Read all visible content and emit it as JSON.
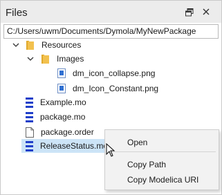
{
  "panel": {
    "title": "Files",
    "float_icon": "float-window-icon",
    "close_icon": "close-icon"
  },
  "path": {
    "value": "C:/Users/uwm/Documents/Dymola/MyNewPackage"
  },
  "tree": {
    "items": [
      {
        "label": "Resources",
        "icon": "folder-icon",
        "expanded": true
      },
      {
        "label": "Images",
        "icon": "folder-icon",
        "expanded": true
      },
      {
        "label": "dm_icon_collapse.png",
        "icon": "image-file-icon"
      },
      {
        "label": "dm_Icon_Constant.png",
        "icon": "image-file-icon"
      },
      {
        "label": "Example.mo",
        "icon": "modelica-file-icon"
      },
      {
        "label": "package.mo",
        "icon": "modelica-file-icon"
      },
      {
        "label": "package.order",
        "icon": "text-file-icon"
      },
      {
        "label": "ReleaseStatus.mo",
        "icon": "modelica-file-icon",
        "selected": true
      }
    ]
  },
  "context_menu": {
    "items": [
      {
        "label": "Open"
      },
      {
        "label": "Copy Path"
      },
      {
        "label": "Copy Modelica URI"
      }
    ]
  },
  "colors": {
    "selection": "#cce4f7",
    "folder": "#f2c14e",
    "modelica": "#1f3fc9",
    "png_accent": "#2f6fd1"
  }
}
